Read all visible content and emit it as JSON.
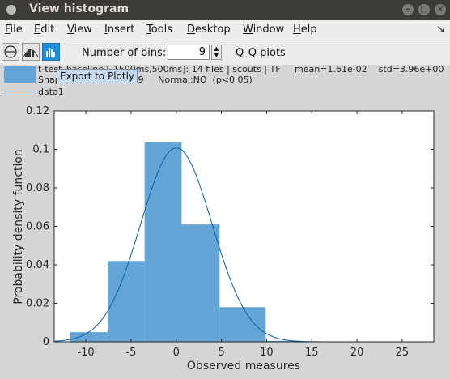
{
  "window": {
    "title": "View histogram",
    "close_glyph": "×"
  },
  "menus": [
    {
      "accel": "F",
      "rest": "ile"
    },
    {
      "accel": "E",
      "rest": "dit"
    },
    {
      "accel": "V",
      "rest": "iew"
    },
    {
      "accel": "I",
      "rest": "nsert"
    },
    {
      "accel": "T",
      "rest": "ools"
    },
    {
      "accel": "D",
      "rest": "esktop"
    },
    {
      "accel": "W",
      "rest": "indow"
    },
    {
      "accel": "H",
      "rest": "elp"
    }
  ],
  "toolbar": {
    "bins_label": "Number of bins:",
    "bins_value": "9",
    "qq_label": "Q-Q plots",
    "tooltip": "Export to Plotly"
  },
  "legend": {
    "line1": "t-test_baseline [-1500ms,500ms]: 14 files | scouts | TF     mean=1.61e-02    std=3.96e+00",
    "line2": "Shapiro-Wilk W=0.9639     Normal:NO  (p<0.05)",
    "line3": "data1"
  },
  "chart_data": {
    "type": "bar",
    "xlabel": "Observed measures",
    "ylabel": "Probability density function",
    "xlim": [
      -13.5,
      28.5
    ],
    "ylim": [
      0,
      0.12
    ],
    "xticks": [
      -10,
      -5,
      0,
      5,
      10,
      15,
      20,
      25
    ],
    "yticks": [
      0,
      0.02,
      0.04,
      0.06,
      0.08,
      0.1,
      0.12
    ],
    "bars": [
      {
        "x0": -11.8,
        "x1": -7.6,
        "value": 0.005
      },
      {
        "x0": -7.6,
        "x1": -3.5,
        "value": 0.042
      },
      {
        "x0": -3.5,
        "x1": 0.6,
        "value": 0.104
      },
      {
        "x0": 0.6,
        "x1": 4.8,
        "value": 0.061
      },
      {
        "x0": 4.8,
        "x1": 9.9,
        "value": 0.018
      },
      {
        "x0": 9.9,
        "x1": 14.0,
        "value": 0.0005
      }
    ],
    "series": [
      {
        "name": "data1",
        "kind": "normal-fit",
        "mean": 0.016,
        "std": 3.96
      }
    ],
    "bar_color": "#64a5d8",
    "line_color": "#0b5fa5"
  }
}
